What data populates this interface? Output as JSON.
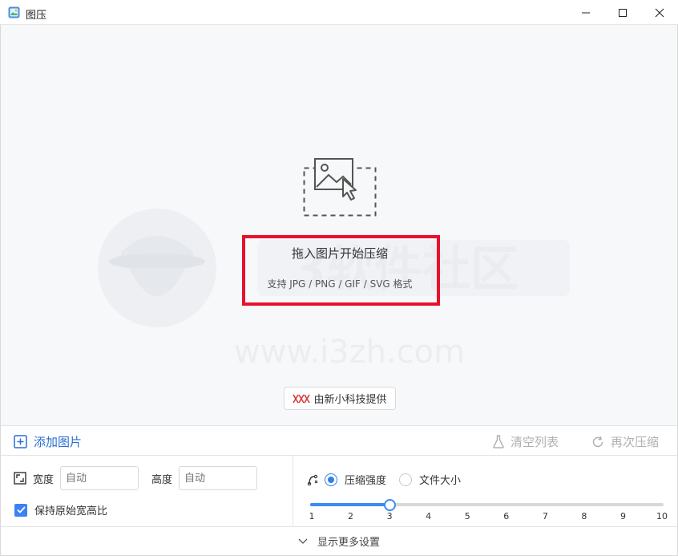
{
  "window": {
    "title": "图压",
    "controls": {
      "minimize": "minimize-icon",
      "maximize": "maximize-icon",
      "close": "close-icon"
    }
  },
  "drop_zone": {
    "title": "拖入图片开始压缩",
    "subtitle": "支持 JPG / PNG / GIF / SVG 格式",
    "provider_label": "由新小科技提供",
    "watermark_text": "3软件社区",
    "watermark_url": "www.i3zh.com"
  },
  "actions": {
    "add_label": "添加图片",
    "clear_label": "清空列表",
    "recompress_label": "再次压缩"
  },
  "settings": {
    "width_label": "宽度",
    "width_placeholder": "自动",
    "height_label": "高度",
    "height_placeholder": "自动",
    "keep_ratio_label": "保持原始宽高比",
    "keep_ratio_checked": true,
    "mode_options": [
      {
        "label": "压缩强度",
        "selected": true
      },
      {
        "label": "文件大小",
        "selected": false
      }
    ],
    "slider": {
      "min": 1,
      "max": 10,
      "value": 3,
      "ticks": [
        "1",
        "2",
        "3",
        "4",
        "5",
        "6",
        "7",
        "8",
        "9",
        "10"
      ]
    },
    "more_label": "显示更多设置"
  },
  "colors": {
    "accent": "#2f80ed",
    "highlight": "#e8112d",
    "drop_bg": "#f7f8fa"
  }
}
